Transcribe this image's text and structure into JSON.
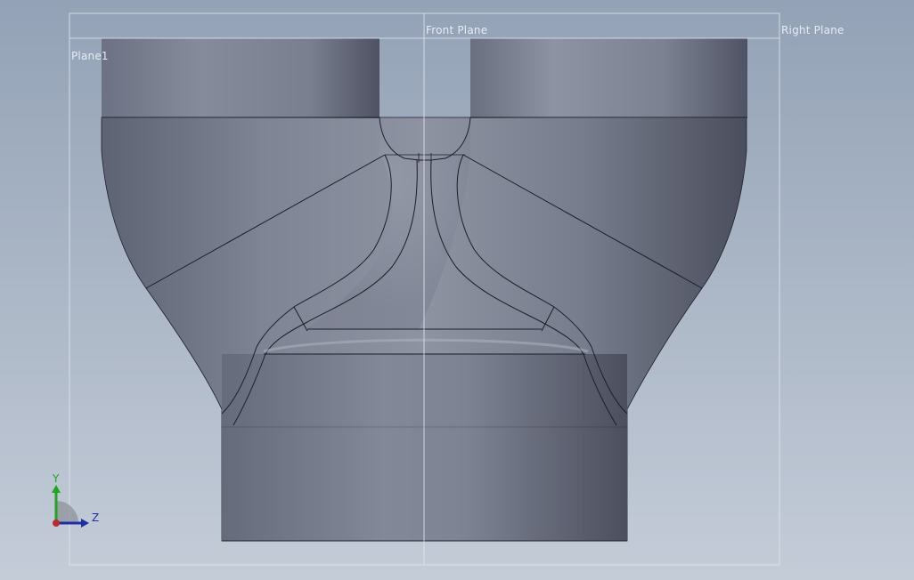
{
  "viewport": {
    "background_top": "#93a2b6",
    "background_bottom": "#c4ccd8",
    "model_color": "#7c8191"
  },
  "planes": {
    "front_label": "Front Plane",
    "right_label": "Right Plane",
    "plane1_label": "Plane1",
    "line_color": "#dfe4eb"
  },
  "triad": {
    "y_label": "Y",
    "z_label": "Z",
    "y_color": "#1fa51f",
    "z_color": "#1b2fa8",
    "origin_color": "#c0262a"
  },
  "model": {
    "name": "Y-branch pipe fitting"
  }
}
